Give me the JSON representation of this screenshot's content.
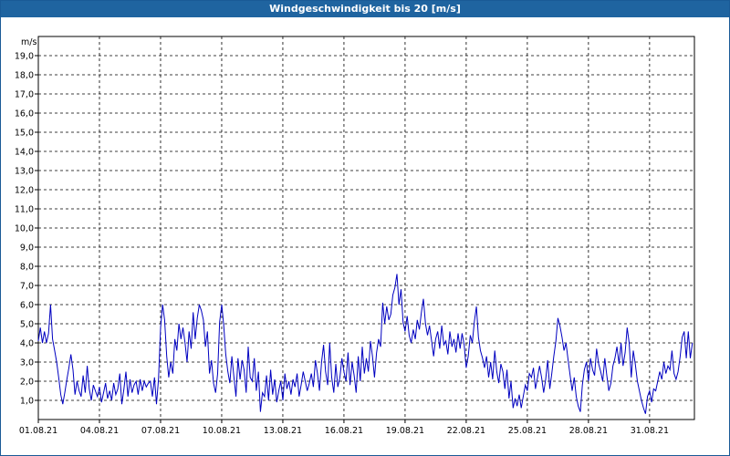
{
  "window": {
    "title": "Windgeschwindigkeit bis 20 [m/s]"
  },
  "chart_data": {
    "type": "line",
    "title": "Windgeschwindigkeit bis 20 [m/s]",
    "ylabel": "m/s",
    "xlabel": "",
    "ylim": [
      0,
      20
    ],
    "yticks": [
      "1,0",
      "2,0",
      "3,0",
      "4,0",
      "5,0",
      "6,0",
      "7,0",
      "8,0",
      "9,0",
      "10,0",
      "11,0",
      "12,0",
      "13,0",
      "14,0",
      "15,0",
      "16,0",
      "17,0",
      "18,0",
      "19,0"
    ],
    "xlim_days": [
      1,
      33.2
    ],
    "xticks": [
      {
        "day": 1,
        "label": "01.08.21"
      },
      {
        "day": 4,
        "label": "04.08.21"
      },
      {
        "day": 7,
        "label": "07.08.21"
      },
      {
        "day": 10,
        "label": "10.08.21"
      },
      {
        "day": 13,
        "label": "13.08.21"
      },
      {
        "day": 16,
        "label": "16.08.21"
      },
      {
        "day": 19,
        "label": "19.08.21"
      },
      {
        "day": 22,
        "label": "22.08.21"
      },
      {
        "day": 25,
        "label": "25.08.21"
      },
      {
        "day": 28,
        "label": "28.08.21"
      },
      {
        "day": 31,
        "label": "31.08.21"
      }
    ],
    "grid": true,
    "line_color": "#0000c0",
    "series": [
      {
        "x_day": [
          1.0,
          1.1,
          1.2,
          1.3,
          1.4,
          1.5,
          1.6,
          1.7,
          1.8,
          1.9,
          2.0,
          2.1,
          2.2,
          2.3,
          2.4,
          2.5,
          2.6,
          2.7,
          2.8,
          2.9,
          3.0,
          3.1,
          3.2,
          3.3,
          3.4,
          3.5,
          3.6,
          3.7,
          3.8,
          3.9,
          4.0,
          4.1,
          4.2,
          4.3,
          4.4,
          4.5,
          4.6,
          4.7,
          4.8,
          4.9,
          5.0,
          5.1,
          5.2,
          5.3,
          5.4,
          5.5,
          5.6,
          5.7,
          5.8,
          5.9,
          6.0,
          6.1,
          6.2,
          6.3,
          6.4,
          6.5,
          6.6,
          6.7,
          6.8,
          6.9,
          7.0,
          7.1,
          7.2,
          7.3,
          7.4,
          7.5,
          7.6,
          7.7,
          7.8,
          7.9,
          8.0,
          8.1,
          8.2,
          8.3,
          8.4,
          8.5,
          8.6,
          8.7,
          8.8,
          8.9,
          9.0,
          9.1,
          9.2,
          9.3,
          9.4,
          9.5,
          9.6,
          9.7,
          9.8,
          9.9,
          10.0,
          10.1,
          10.2,
          10.3,
          10.4,
          10.5,
          10.6,
          10.7,
          10.8,
          10.9,
          11.0,
          11.1,
          11.2,
          11.3,
          11.4,
          11.5,
          11.6,
          11.7,
          11.8,
          11.9,
          12.0,
          12.1,
          12.2,
          12.3,
          12.4,
          12.5,
          12.6,
          12.7,
          12.8,
          12.9,
          13.0,
          13.1,
          13.2,
          13.3,
          13.4,
          13.5,
          13.6,
          13.7,
          13.8,
          13.9,
          14.0,
          14.1,
          14.2,
          14.3,
          14.4,
          14.5,
          14.6,
          14.7,
          14.8,
          14.9,
          15.0,
          15.1,
          15.2,
          15.3,
          15.4,
          15.5,
          15.6,
          15.7,
          15.8,
          15.9,
          16.0,
          16.1,
          16.2,
          16.3,
          16.4,
          16.5,
          16.6,
          16.7,
          16.8,
          16.9,
          17.0,
          17.1,
          17.2,
          17.3,
          17.4,
          17.5,
          17.6,
          17.7,
          17.8,
          17.9,
          18.0,
          18.1,
          18.2,
          18.3,
          18.4,
          18.5,
          18.6,
          18.7,
          18.8,
          18.9,
          19.0,
          19.1,
          19.2,
          19.3,
          19.4,
          19.5,
          19.6,
          19.7,
          19.8,
          19.9,
          20.0,
          20.1,
          20.2,
          20.3,
          20.4,
          20.5,
          20.6,
          20.7,
          20.8,
          20.9,
          21.0,
          21.1,
          21.2,
          21.3,
          21.4,
          21.5,
          21.6,
          21.7,
          21.8,
          21.9,
          22.0,
          22.1,
          22.2,
          22.3,
          22.4,
          22.5,
          22.6,
          22.7,
          22.8,
          22.9,
          23.0,
          23.1,
          23.2,
          23.3,
          23.4,
          23.5,
          23.6,
          23.7,
          23.8,
          23.9,
          24.0,
          24.1,
          24.2,
          24.3,
          24.4,
          24.5,
          24.6,
          24.7,
          24.8,
          24.9,
          25.0,
          25.1,
          25.2,
          25.3,
          25.4,
          25.5,
          25.6,
          25.7,
          25.8,
          25.9,
          26.0,
          26.1,
          26.2,
          26.3,
          26.4,
          26.5,
          26.6,
          26.7,
          26.8,
          26.9,
          27.0,
          27.1,
          27.2,
          27.3,
          27.4,
          27.5,
          27.6,
          27.7,
          27.8,
          27.9,
          28.0,
          28.1,
          28.2,
          28.3,
          28.4,
          28.5,
          28.6,
          28.7,
          28.8,
          28.9,
          29.0,
          29.1,
          29.2,
          29.3,
          29.4,
          29.5,
          29.6,
          29.7,
          29.8,
          29.9,
          30.0,
          30.1,
          30.2,
          30.3,
          30.4,
          30.5,
          30.6,
          30.7,
          30.8,
          30.9,
          31.0,
          31.1,
          31.2,
          31.3,
          31.4,
          31.5,
          31.6,
          31.7,
          31.8,
          31.9,
          32.0,
          32.1,
          32.2,
          32.3,
          32.4,
          32.5,
          32.6,
          32.7,
          32.8,
          32.9,
          33.0,
          33.1
        ],
        "values": [
          4.1,
          4.8,
          4.0,
          4.6,
          4.0,
          4.5,
          6.0,
          4.2,
          3.6,
          3.0,
          2.2,
          1.3,
          0.8,
          1.4,
          2.1,
          2.7,
          3.4,
          2.6,
          1.3,
          2.0,
          1.5,
          1.2,
          2.3,
          1.4,
          2.8,
          1.6,
          1.0,
          1.8,
          1.5,
          1.2,
          1.7,
          0.9,
          1.4,
          1.9,
          1.1,
          1.5,
          1.0,
          1.9,
          1.3,
          1.6,
          2.4,
          0.8,
          1.6,
          2.5,
          1.2,
          2.1,
          1.4,
          1.8,
          2.0,
          1.3,
          2.1,
          1.5,
          2.0,
          1.7,
          1.9,
          2.0,
          1.2,
          2.2,
          0.8,
          2.1,
          4.8,
          6.0,
          5.2,
          3.3,
          2.2,
          3.0,
          2.4,
          4.2,
          3.6,
          5.0,
          4.2,
          4.8,
          4.0,
          3.0,
          4.6,
          3.7,
          5.6,
          4.2,
          5.3,
          6.0,
          5.7,
          5.2,
          3.8,
          4.6,
          2.4,
          3.1,
          1.9,
          1.4,
          2.4,
          5.1,
          6.0,
          4.9,
          3.4,
          2.5,
          1.9,
          3.3,
          2.2,
          1.2,
          3.2,
          2.1,
          3.1,
          2.6,
          1.4,
          3.8,
          2.2,
          2.0,
          3.2,
          1.5,
          2.5,
          0.4,
          1.4,
          1.2,
          2.3,
          1.0,
          2.6,
          1.3,
          2.1,
          0.9,
          1.5,
          2.0,
          1.0,
          2.4,
          1.6,
          2.0,
          1.3,
          2.1,
          1.7,
          2.4,
          1.2,
          1.8,
          2.5,
          2.0,
          1.5,
          1.9,
          2.4,
          1.7,
          3.1,
          2.4,
          1.5,
          3.0,
          3.9,
          2.5,
          1.8,
          4.0,
          2.2,
          1.4,
          2.9,
          1.7,
          2.2,
          3.2,
          2.5,
          2.0,
          3.5,
          1.8,
          3.0,
          2.3,
          1.4,
          3.3,
          2.0,
          3.8,
          2.4,
          3.2,
          2.5,
          4.1,
          3.3,
          2.2,
          3.5,
          4.2,
          3.8,
          6.1,
          5.0,
          5.9,
          5.2,
          5.5,
          6.5,
          6.9,
          7.6,
          6.0,
          6.8,
          5.1,
          4.6,
          5.4,
          4.4,
          4.0,
          4.7,
          4.2,
          5.2,
          4.7,
          5.6,
          6.3,
          5.0,
          4.4,
          4.9,
          4.1,
          3.3,
          4.2,
          4.6,
          3.7,
          4.9,
          3.9,
          4.1,
          3.4,
          4.6,
          3.8,
          4.2,
          3.5,
          4.5,
          3.7,
          4.5,
          3.9,
          2.7,
          3.3,
          4.4,
          4.0,
          5.1,
          5.9,
          4.3,
          3.6,
          3.2,
          2.7,
          3.3,
          2.2,
          3.0,
          2.1,
          3.6,
          2.5,
          1.9,
          2.9,
          2.5,
          1.6,
          2.6,
          1.1,
          2.0,
          0.6,
          1.1,
          0.7,
          1.3,
          0.6,
          1.2,
          1.8,
          1.5,
          2.4,
          2.2,
          2.7,
          1.6,
          2.2,
          2.8,
          2.2,
          1.4,
          2.1,
          3.1,
          1.6,
          2.4,
          3.3,
          4.1,
          5.3,
          4.9,
          4.3,
          3.6,
          4.0,
          3.1,
          2.3,
          1.5,
          2.2,
          1.2,
          0.7,
          0.4,
          1.8,
          2.6,
          3.0,
          2.0,
          3.2,
          2.6,
          2.3,
          3.7,
          2.9,
          2.5,
          2.0,
          3.2,
          2.3,
          1.5,
          1.9,
          2.8,
          3.2,
          3.8,
          2.9,
          4.0,
          2.8,
          3.5,
          4.8,
          4.0,
          2.2,
          3.6,
          2.9,
          2.0,
          1.5,
          1.0,
          0.6,
          0.3,
          1.2,
          1.5,
          0.9,
          1.6,
          1.5,
          2.0,
          2.5,
          2.1,
          3.0,
          2.4,
          2.8,
          2.6,
          3.6,
          2.4,
          2.1,
          2.5,
          3.3,
          4.3,
          4.6,
          3.2,
          4.6,
          3.2,
          4.0,
          2.9,
          3.4,
          3.9,
          4.5,
          3.8,
          3.4,
          3.0,
          2.6,
          3.1,
          2.8,
          2.2,
          2.7,
          2.5,
          3.2,
          3.6,
          3.3,
          2.6,
          2.3,
          2.8,
          2.5,
          2.7,
          2.4,
          2.6,
          2.9,
          3.3,
          3.5,
          3.1,
          2.6,
          2.7,
          3.0,
          2.8,
          2.5,
          3.3,
          2.9,
          3.4,
          2.9,
          3.3,
          4.3,
          2.8,
          3.9,
          4.1,
          3.4,
          4.5,
          3.7,
          3.1,
          4.0,
          3.3,
          3.0,
          2.4,
          2.6,
          3.0,
          2.9,
          3.2,
          3.5,
          2.8,
          2.3,
          3.2,
          3.4,
          3.8
        ]
      }
    ]
  }
}
